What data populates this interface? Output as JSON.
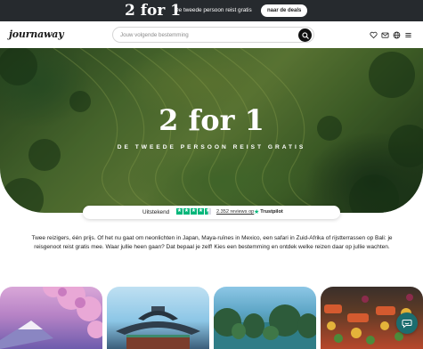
{
  "promo": {
    "headline": "2 for 1",
    "text": "De tweede persoon reist gratis",
    "button_label": "naar de deals"
  },
  "header": {
    "logo": "journaway",
    "search_placeholder": "Jouw volgende bestemming",
    "icons": [
      "heart-icon",
      "mail-icon",
      "globe-icon",
      "menu-icon"
    ]
  },
  "hero": {
    "title": "2 for 1",
    "subtitle": "DE TWEEDE PERSOON REIST GRATIS"
  },
  "trust": {
    "label": "Uitstekend",
    "stars": 4.5,
    "reviews": "2.352 reviews op",
    "brand": "Trustpilot"
  },
  "intro": {
    "text": "Twee reizigers, één prijs. Of het nu gaat om neonlichten in Japan, Maya-ruïnes in Mexico, een safari in Zuid-Afrika of rijstterrassen op Bali: je reisgenoot reist gratis mee. Waar jullie heen gaan? Dat bepaal je zelf! Kies een bestemming en ontdek welke reizen daar op jullie wachten."
  },
  "cards": [
    {
      "scene": "cherry-blossom-mountain"
    },
    {
      "scene": "temple-roof"
    },
    {
      "scene": "bay-islands"
    },
    {
      "scene": "floating-market"
    }
  ],
  "colors": {
    "promo_bg": "#262a2e",
    "trust_green": "#00b67a",
    "chat": "#1c6d6f"
  }
}
